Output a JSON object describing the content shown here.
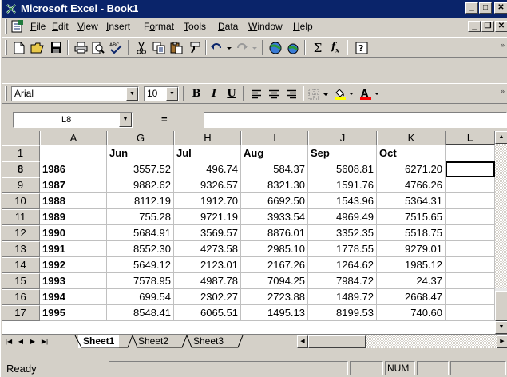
{
  "window": {
    "title": "Microsoft Excel - Book1"
  },
  "menu": [
    "File",
    "Edit",
    "View",
    "Insert",
    "Format",
    "Tools",
    "Data",
    "Window",
    "Help"
  ],
  "format_toolbar": {
    "font": "Arial",
    "size": "10",
    "bold": "B",
    "italic": "I",
    "underline": "U"
  },
  "formula_bar": {
    "cell_ref": "L8",
    "equals": "=",
    "value": ""
  },
  "columns": [
    "A",
    "G",
    "H",
    "I",
    "J",
    "K",
    "L"
  ],
  "header_row": {
    "row_no": "1",
    "months": [
      "Jun",
      "Jul",
      "Aug",
      "Sep",
      "Oct"
    ]
  },
  "rows": [
    {
      "row_no": "8",
      "year": "1986",
      "values": [
        "3557.52",
        "496.74",
        "584.37",
        "5608.81",
        "6271.20"
      ]
    },
    {
      "row_no": "9",
      "year": "1987",
      "values": [
        "9882.62",
        "9326.57",
        "8321.30",
        "1591.76",
        "4766.26"
      ]
    },
    {
      "row_no": "10",
      "year": "1988",
      "values": [
        "8112.19",
        "1912.70",
        "6692.50",
        "1543.96",
        "5364.31"
      ]
    },
    {
      "row_no": "11",
      "year": "1989",
      "values": [
        "755.28",
        "9721.19",
        "3933.54",
        "4969.49",
        "7515.65"
      ]
    },
    {
      "row_no": "12",
      "year": "1990",
      "values": [
        "5684.91",
        "3569.57",
        "8876.01",
        "3352.35",
        "5518.75"
      ]
    },
    {
      "row_no": "13",
      "year": "1991",
      "values": [
        "8552.30",
        "4273.58",
        "2985.10",
        "1778.55",
        "9279.01"
      ]
    },
    {
      "row_no": "14",
      "year": "1992",
      "values": [
        "5649.12",
        "2123.01",
        "2167.26",
        "1264.62",
        "1985.12"
      ]
    },
    {
      "row_no": "15",
      "year": "1993",
      "values": [
        "7578.95",
        "4987.78",
        "7094.25",
        "7984.72",
        "24.37"
      ]
    },
    {
      "row_no": "16",
      "year": "1994",
      "values": [
        "699.54",
        "2302.27",
        "2723.88",
        "1489.72",
        "2668.47"
      ]
    },
    {
      "row_no": "17",
      "year": "1995",
      "values": [
        "8548.41",
        "6065.51",
        "1495.13",
        "8199.53",
        "740.60"
      ]
    }
  ],
  "sheets": [
    "Sheet1",
    "Sheet2",
    "Sheet3"
  ],
  "status": {
    "text": "Ready",
    "num": "NUM"
  }
}
